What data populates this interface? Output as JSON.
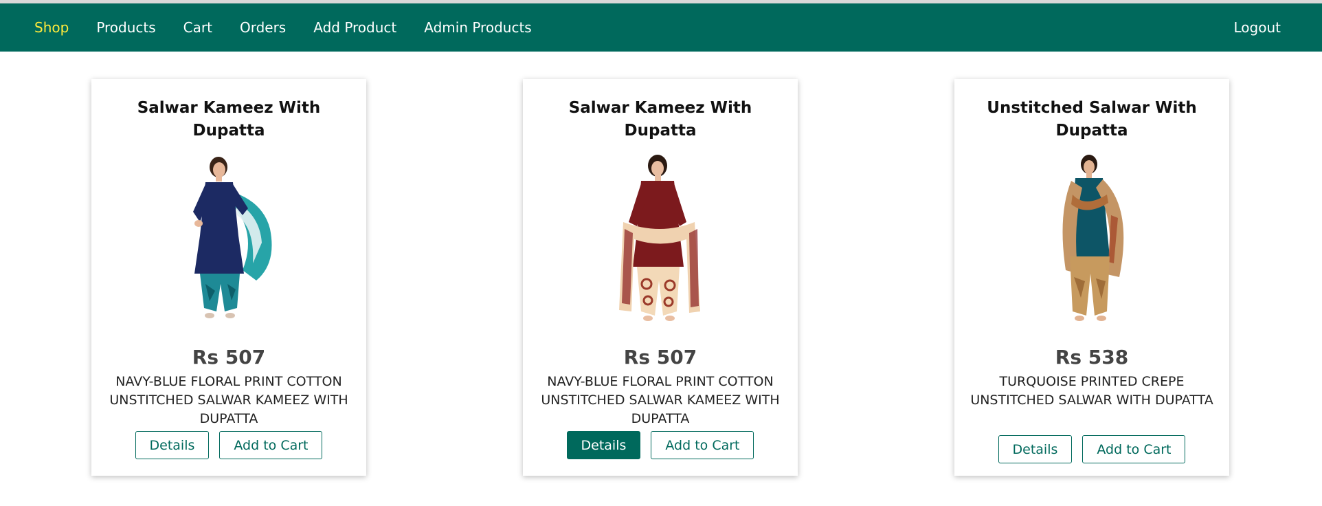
{
  "nav": {
    "items": [
      {
        "label": "Shop",
        "active": true
      },
      {
        "label": "Products",
        "active": false
      },
      {
        "label": "Cart",
        "active": false
      },
      {
        "label": "Orders",
        "active": false
      },
      {
        "label": "Add Product",
        "active": false
      },
      {
        "label": "Admin Products",
        "active": false
      }
    ],
    "logout_label": "Logout"
  },
  "colors": {
    "primary": "#00695c",
    "active_link": "#ffeb3b",
    "price_text": "#444444"
  },
  "products": [
    {
      "title": "Salwar Kameez With Dupatta",
      "price": "Rs 507",
      "description": "NAVY-BLUE FLORAL PRINT COTTON UNSTITCHED SALWAR KAMEEZ WITH DUPATTA",
      "details_label": "Details",
      "cart_label": "Add to Cart",
      "image": "navy-blue-salwar-kameez-photo"
    },
    {
      "title": "Salwar Kameez With Dupatta",
      "price": "Rs 507",
      "description": "NAVY-BLUE FLORAL PRINT COTTON UNSTITCHED SALWAR KAMEEZ WITH DUPATTA",
      "details_label": "Details",
      "cart_label": "Add to Cart",
      "image": "maroon-salwar-kameez-photo"
    },
    {
      "title": "Unstitched Salwar With Dupatta",
      "price": "Rs 538",
      "description": "TURQUOISE PRINTED CREPE UNSTITCHED SALWAR WITH DUPATTA",
      "details_label": "Details",
      "cart_label": "Add to Cart",
      "image": "turquoise-salwar-photo"
    }
  ]
}
